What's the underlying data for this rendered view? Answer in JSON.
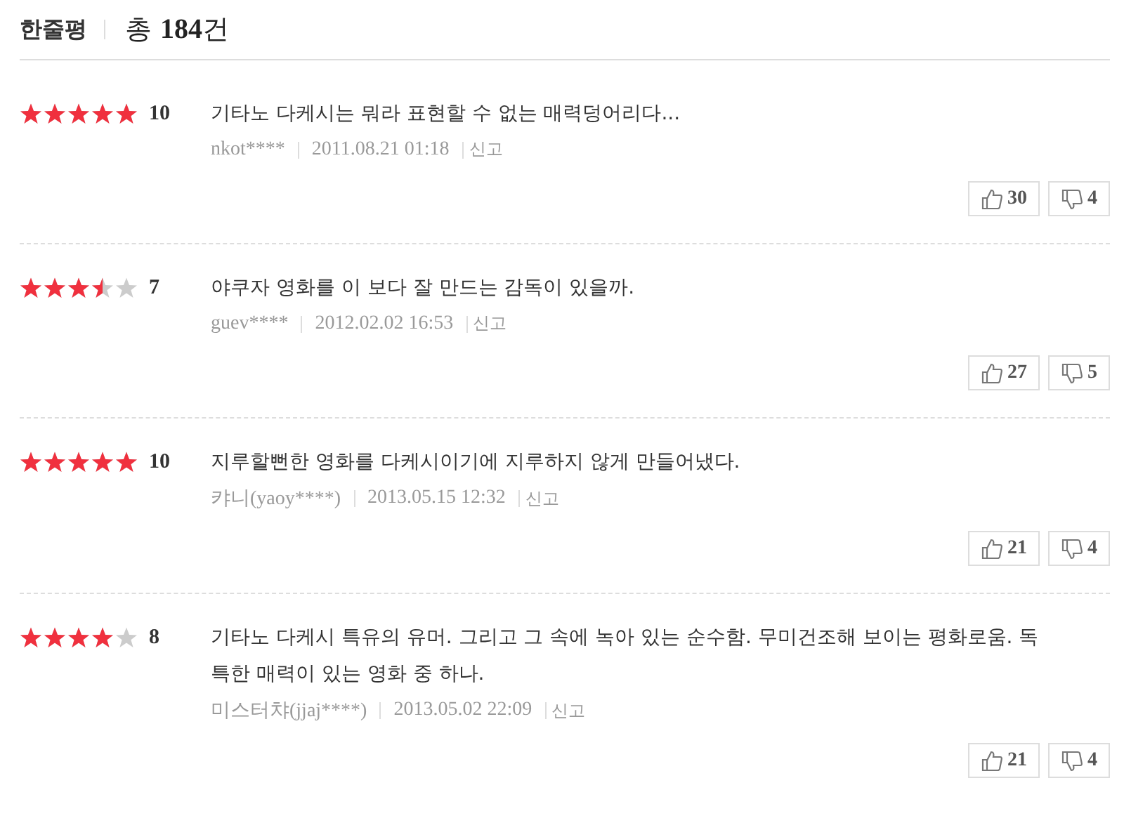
{
  "header": {
    "title": "한줄평",
    "total_prefix": "총",
    "total_count": "184",
    "total_suffix": "건"
  },
  "reviews": [
    {
      "stars": 5,
      "score": "10",
      "text": "기타노 다케시는 뭐라 표현할 수 없는 매력덩어리다...",
      "author": "nkot****",
      "date": "2011.08.21 01:18",
      "report": "신고",
      "likes": "30",
      "dislikes": "4"
    },
    {
      "stars": 3.5,
      "score": "7",
      "text": "야쿠자 영화를 이 보다 잘 만드는 감독이 있을까.",
      "author": "guev****",
      "date": "2012.02.02 16:53",
      "report": "신고",
      "likes": "27",
      "dislikes": "5"
    },
    {
      "stars": 5,
      "score": "10",
      "text": "지루할뻔한 영화를 다케시이기에 지루하지 않게 만들어냈다.",
      "author": "캬니(yaoy****)",
      "date": "2013.05.15 12:32",
      "report": "신고",
      "likes": "21",
      "dislikes": "4"
    },
    {
      "stars": 4,
      "score": "8",
      "text": "기타노 다케시 특유의 유머. 그리고 그 속에 녹아 있는 순수함. 무미건조해 보이는 평화로움. 독특한 매력이 있는 영화 중 하나.",
      "author": "미스터챠(jjaj****)",
      "date": "2013.05.02 22:09",
      "report": "신고",
      "likes": "21",
      "dislikes": "4"
    }
  ]
}
